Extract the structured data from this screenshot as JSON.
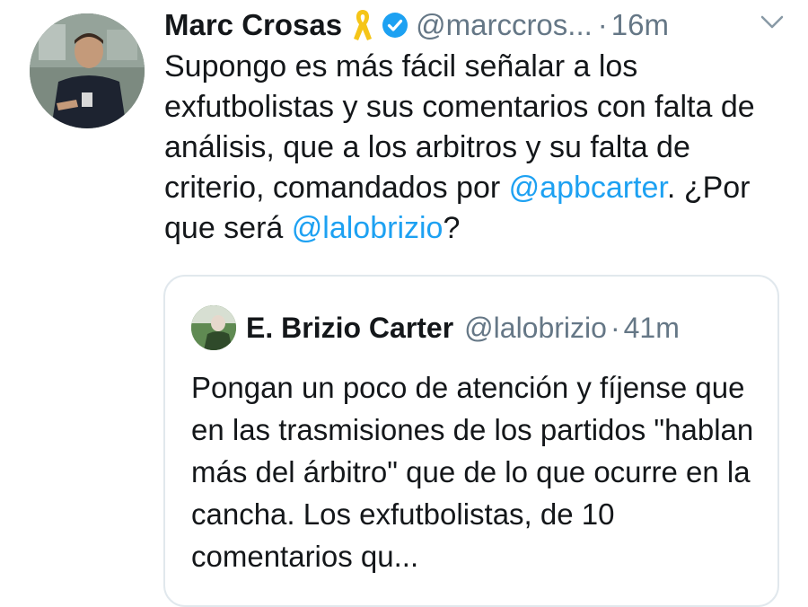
{
  "tweet": {
    "author": {
      "name": "Marc Crosas",
      "handle": "@marccros...",
      "separator": "·",
      "time": "16m"
    },
    "text": {
      "part1": "Supongo es más fácil señalar a los exfutbolistas y sus comentarios con falta de análisis, que a los arbitros y su falta de criterio, comandados por ",
      "mention1": "@apbcarter",
      "part2": ". ¿Por que será ",
      "mention2": "@lalobrizio",
      "part3": "?"
    },
    "icons": {
      "ribbon": "yellow-ribbon-icon",
      "verified": "verified-badge-icon",
      "menu": "chevron-down-icon"
    }
  },
  "quoted_tweet": {
    "author": {
      "name": "E. Brizio Carter",
      "handle": "@lalobrizio",
      "separator": "·",
      "time": "41m"
    },
    "text": "Pongan un poco de atención y fíjense que en las trasmisiones de los partidos \"hablan más del árbitro\" que de lo que ocurre en la cancha. Los exfutbolistas, de 10 comentarios qu..."
  },
  "colors": {
    "text": "#14171a",
    "secondary": "#657786",
    "link": "#1da1f2",
    "border": "#e1e8ed",
    "ribbon": "#f5c518"
  }
}
